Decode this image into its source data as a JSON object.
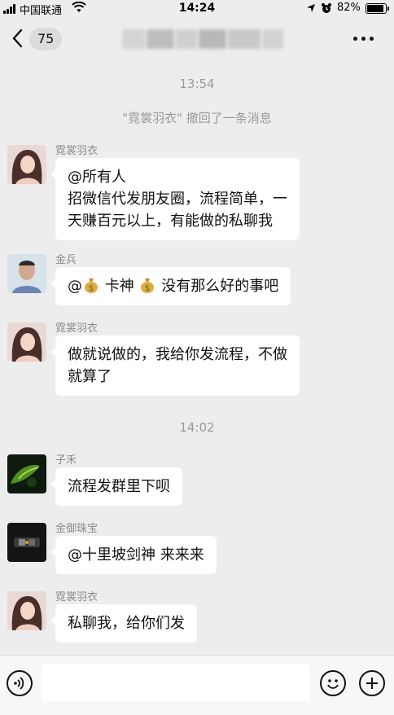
{
  "status_bar": {
    "carrier": "中国联通",
    "time": "14:24",
    "battery": "82%",
    "battery_level": 0.82
  },
  "nav": {
    "unread_count": "75"
  },
  "timestamps": [
    "13:54",
    "14:02"
  ],
  "recall_notice": "\"霓裳羽衣\" 撤回了一条消息",
  "messages": [
    {
      "sender": "霓裳羽衣",
      "lines": [
        "@所有人",
        "招微信代发朋友圈，流程简单，一",
        "天赚百元以上，有能做的私聊我"
      ]
    },
    {
      "sender": "金兵",
      "parts": [
        "@",
        "卡神",
        "没有那么好的事吧"
      ]
    },
    {
      "sender": "霓裳羽衣",
      "lines": [
        "做就说做的，我给你发流程，不做",
        "就算了"
      ]
    },
    {
      "sender": "子禾",
      "lines": [
        "流程发群里下呗"
      ]
    },
    {
      "sender": "金御珠宝",
      "lines": [
        "@十里坡剑神 来来来"
      ]
    },
    {
      "sender": "霓裳羽衣",
      "lines": [
        "私聊我，给你们发"
      ]
    }
  ],
  "icons": {
    "back": "chevron-left-icon",
    "more": "more-dots-icon",
    "voice": "voice-icon",
    "emoji": "emoji-icon",
    "plus": "plus-icon",
    "money_bag": "money-bag-icon"
  },
  "colors": {
    "background": "#ededed",
    "bubble": "#ffffff",
    "meta_text": "#9a9a9a"
  }
}
